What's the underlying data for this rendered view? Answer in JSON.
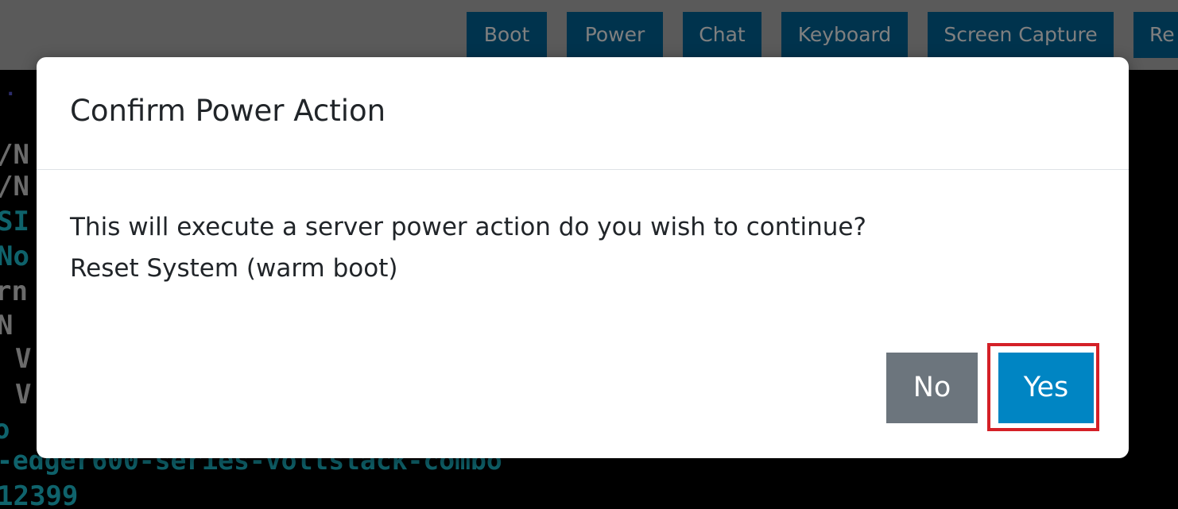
{
  "toolbar": {
    "buttons": [
      "Boot",
      "Power",
      "Chat",
      "Keyboard",
      "Screen Capture",
      "Re"
    ]
  },
  "console": {
    "lines": [
      ".",
      "/N",
      "/N",
      "SI",
      "No",
      "rn",
      "N",
      "• V",
      "• V",
      "o",
      "-edger600-series-voltstack-combo",
      "12399"
    ]
  },
  "dialog": {
    "title": "Confirm Power Action",
    "message": "This will execute a server power action do you wish to continue?",
    "action": "Reset System (warm boot)",
    "no_label": "No",
    "yes_label": "Yes"
  },
  "colors": {
    "toolbar_button": "#00679a",
    "primary_button": "#0085c3",
    "secondary_button": "#6c757d",
    "highlight": "#d42027"
  }
}
